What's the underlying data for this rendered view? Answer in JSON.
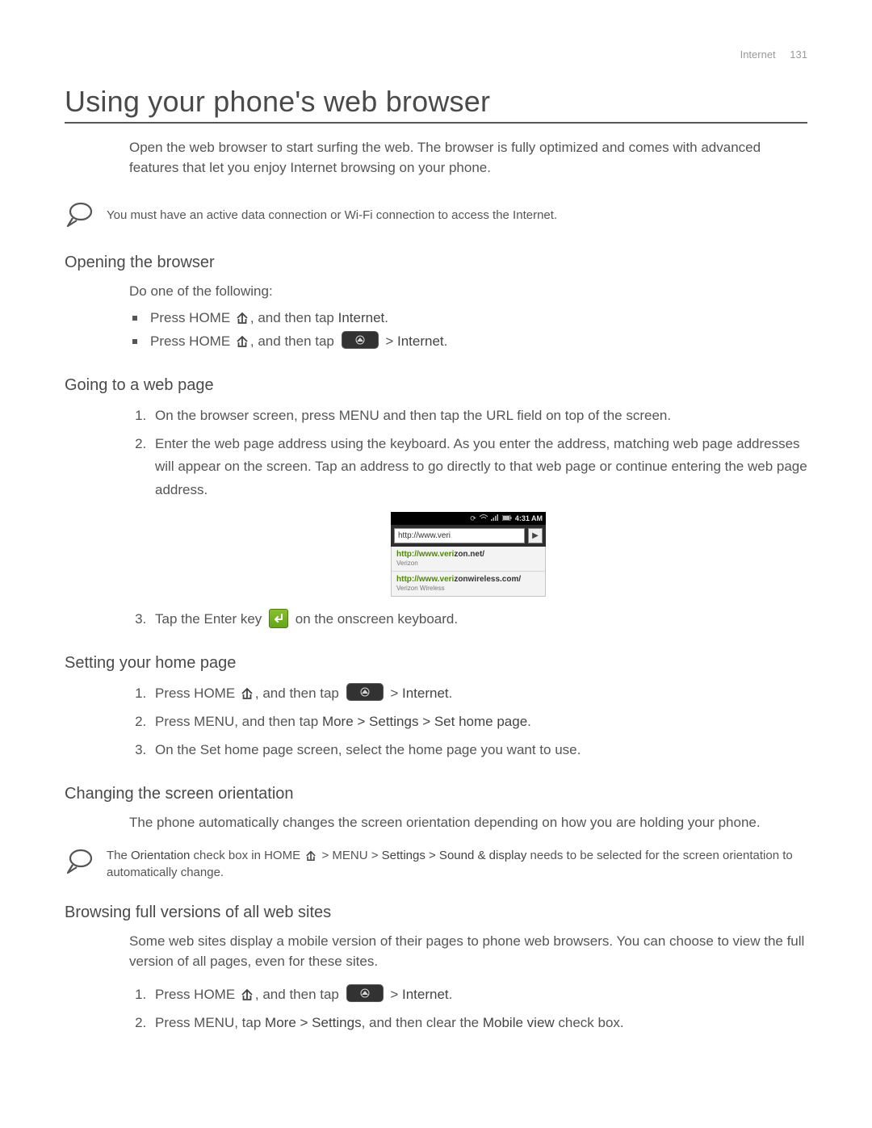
{
  "header": {
    "section": "Internet",
    "page": "131"
  },
  "title": "Using your phone's web browser",
  "intro": "Open the web browser to start surfing the web. The browser is fully optimized and comes with advanced features that let you enjoy Internet browsing on your phone.",
  "note1": "You must have an active data connection or Wi-Fi connection to access the Internet.",
  "opening": {
    "heading": "Opening the browser",
    "lead": "Do one of the following:",
    "b1_pre": "Press HOME ",
    "b1_mid": ", and then tap ",
    "b1_bold": "Internet",
    "b2_pre": "Press HOME ",
    "b2_mid": ", and then tap ",
    "b2_gt": " > ",
    "b2_bold": "Internet"
  },
  "going": {
    "heading": "Going to a web page",
    "s1": "On the browser screen, press MENU and then tap the URL field on top of the screen.",
    "s2": "Enter the web page address using the keyboard. As you enter the address, matching web page addresses will appear on the screen. Tap an address to go directly to that web page or continue entering the web page address.",
    "s3_pre": "Tap the Enter key ",
    "s3_post": " on the onscreen keyboard."
  },
  "phone": {
    "time": "4:31 AM",
    "typed_match": "http://www.veri",
    "sugg1_match": "http://www.veri",
    "sugg1_rest": "zon.net/",
    "sugg1_label": "Verizon",
    "sugg2_match": "http://www.veri",
    "sugg2_rest": "zonwireless.com/",
    "sugg2_label": "Verizon Wireless"
  },
  "home": {
    "heading": "Setting your home page",
    "s1_pre": "Press HOME ",
    "s1_mid": ", and then tap ",
    "s1_gt": " > ",
    "s1_bold": "Internet",
    "s2_pre": "Press MENU, and then tap ",
    "s2_bold": "More > Settings > Set home page",
    "s3": "On the Set home page screen, select the home page you want to use."
  },
  "orient": {
    "heading": "Changing the screen orientation",
    "para": "The phone automatically changes the screen orientation depending on how you are holding your phone.",
    "note_pre": "The ",
    "note_bold1": "Orientation",
    "note_mid1": " check box in HOME ",
    "note_mid2": " > MENU > ",
    "note_bold2": "Settings > Sound & display",
    "note_post": " needs to be selected for the screen orientation to automatically change."
  },
  "full": {
    "heading": "Browsing full versions of all web sites",
    "para": "Some web sites display a mobile version of their pages to phone web browsers. You can choose to view the full version of all pages, even for these sites.",
    "s1_pre": "Press HOME ",
    "s1_mid": ", and then tap ",
    "s1_gt": " > ",
    "s1_bold": "Internet",
    "s2_pre": "Press MENU, tap ",
    "s2_bold": "More > Settings",
    "s2_mid": ", and then clear the ",
    "s2_bold2": "Mobile view",
    "s2_post": " check box."
  }
}
